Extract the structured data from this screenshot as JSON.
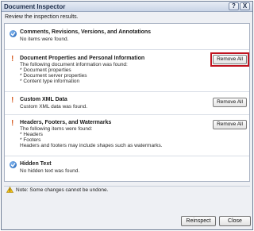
{
  "window": {
    "title": "Document Inspector",
    "help_glyph": "?",
    "close_glyph": "X"
  },
  "subtitle": "Review the inspection results.",
  "sections": [
    {
      "status": "ok",
      "title": "Comments, Revisions, Versions, and Annotations",
      "lines": [
        "No items were found."
      ]
    },
    {
      "status": "found",
      "title": "Document Properties and Personal Information",
      "lines": [
        "The following document information was found:",
        "* Document properties",
        "* Document server properties",
        "* Content type information"
      ],
      "button": "Remove All",
      "highlighted": true
    },
    {
      "status": "found",
      "title": "Custom XML Data",
      "lines": [
        "Custom XML data was found."
      ],
      "button": "Remove All"
    },
    {
      "status": "found",
      "title": "Headers, Footers, and Watermarks",
      "lines": [
        "The following items were found:",
        "* Headers",
        "* Footers",
        "Headers and footers may include shapes such as watermarks."
      ],
      "button": "Remove All"
    },
    {
      "status": "ok",
      "title": "Hidden Text",
      "lines": [
        "No hidden text was found."
      ]
    }
  ],
  "note": "Note: Some changes cannot be undone.",
  "buttons": {
    "reinspect": "Reinspect",
    "close": "Close"
  },
  "colors": {
    "highlight": "#c0131f",
    "warning": "#d8622a",
    "ok": "#1c5fb4"
  },
  "icons": {
    "ok": "check-circle-icon",
    "found": "exclamation-icon",
    "note": "warning-triangle-icon"
  }
}
